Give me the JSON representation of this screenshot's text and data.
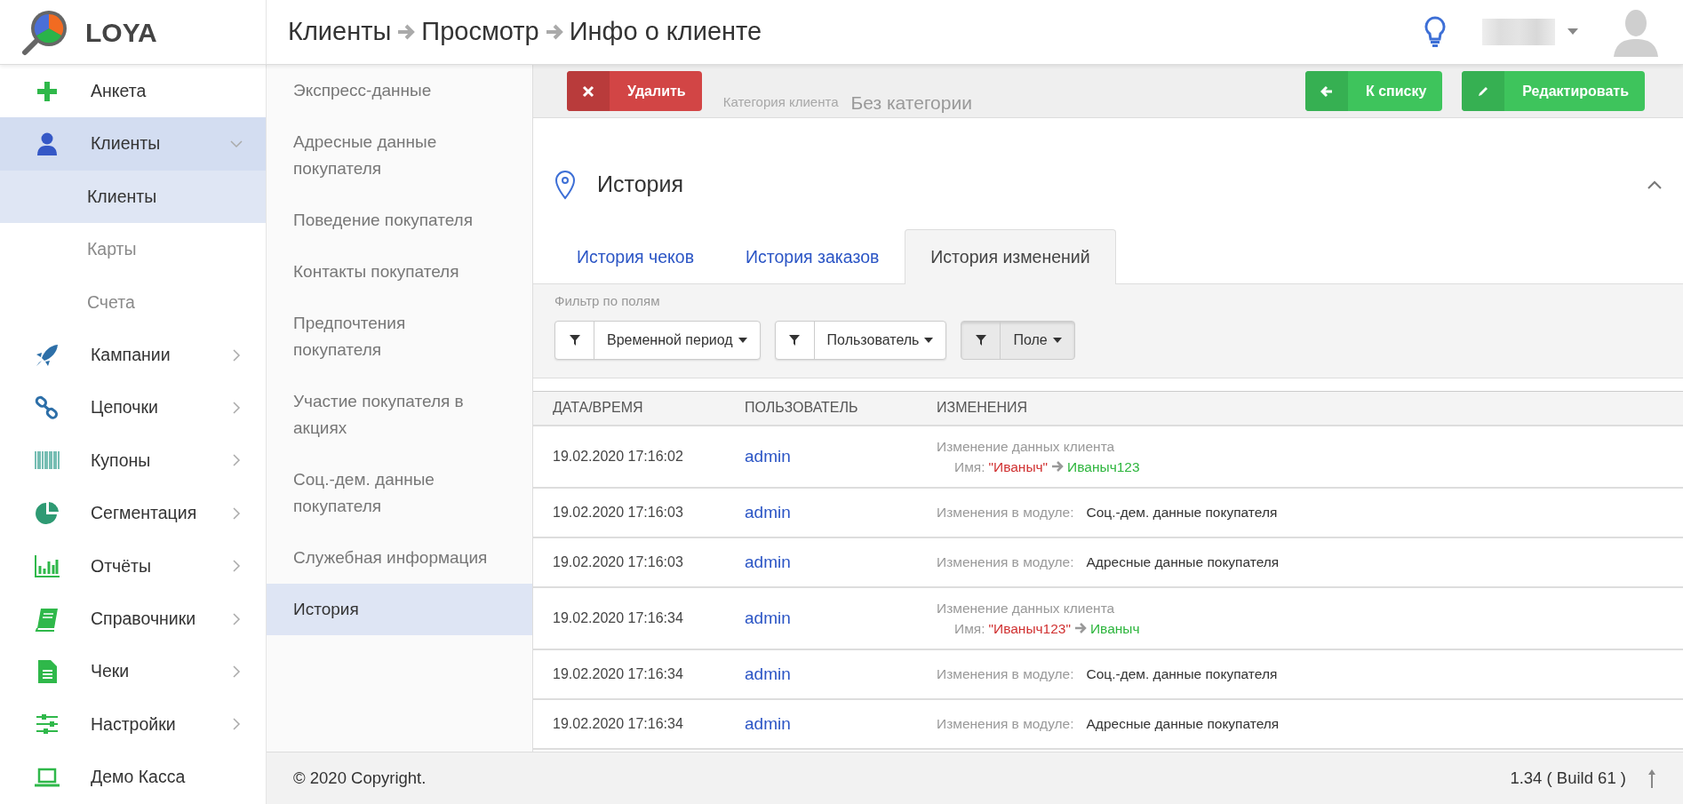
{
  "brand": {
    "name": "LOYA"
  },
  "breadcrumb": [
    "Клиенты",
    "Просмотр",
    "Инфо о клиенте"
  ],
  "sidebar": {
    "items": [
      {
        "label": "Анкета",
        "kind": "plain",
        "selected": false
      },
      {
        "label": "Клиенты",
        "kind": "group",
        "expanded": true,
        "selected": true
      },
      {
        "label": "Клиенты",
        "kind": "sub",
        "selected": true
      },
      {
        "label": "Карты",
        "kind": "sub",
        "selected": false
      },
      {
        "label": "Счета",
        "kind": "sub",
        "selected": false
      },
      {
        "label": "Кампании",
        "kind": "group",
        "expanded": false,
        "selected": false
      },
      {
        "label": "Цепочки",
        "kind": "group",
        "expanded": false,
        "selected": false
      },
      {
        "label": "Купоны",
        "kind": "group",
        "expanded": false,
        "selected": false
      },
      {
        "label": "Сегментация",
        "kind": "group",
        "expanded": false,
        "selected": false
      },
      {
        "label": "Отчёты",
        "kind": "group",
        "expanded": false,
        "selected": false
      },
      {
        "label": "Справочники",
        "kind": "group",
        "expanded": false,
        "selected": false
      },
      {
        "label": "Чеки",
        "kind": "group",
        "expanded": false,
        "selected": false
      },
      {
        "label": "Настройки",
        "kind": "group",
        "expanded": false,
        "selected": false
      },
      {
        "label": "Демо Касса",
        "kind": "plain",
        "selected": false
      }
    ]
  },
  "section_nav": {
    "items": [
      {
        "label": "Экспресс-данные",
        "selected": false
      },
      {
        "label": "Адресные данные покупателя",
        "selected": false
      },
      {
        "label": "Поведение покупателя",
        "selected": false
      },
      {
        "label": "Контакты покупателя",
        "selected": false
      },
      {
        "label": "Предпочтения покупателя",
        "selected": false
      },
      {
        "label": "Участие покупателя в акциях",
        "selected": false
      },
      {
        "label": "Соц.-дем. данные покупателя",
        "selected": false
      },
      {
        "label": "Служебная информация",
        "selected": false
      },
      {
        "label": "История",
        "selected": true
      }
    ]
  },
  "action_bar": {
    "background_field": {
      "label": "Категория клиента",
      "value": "Без категории"
    },
    "buttons": [
      {
        "label": "Удалить",
        "kind": "danger"
      },
      {
        "label": "К списку",
        "kind": "success"
      },
      {
        "label": "Редактировать",
        "kind": "success"
      }
    ]
  },
  "section": {
    "title": "История",
    "expanded": true
  },
  "tabs": [
    {
      "label": "История чеков",
      "selected": false
    },
    {
      "label": "История заказов",
      "selected": false
    },
    {
      "label": "История изменений",
      "selected": true
    }
  ],
  "filter": {
    "label": "Фильтр по полям",
    "filters": [
      {
        "label": "Временной период",
        "active": false
      },
      {
        "label": "Пользователь",
        "active": false
      },
      {
        "label": "Поле",
        "active": true
      }
    ]
  },
  "table": {
    "columns": [
      "ДАТА/ВРЕМЯ",
      "ПОЛЬЗОВАТЕЛЬ",
      "ИЗМЕНЕНИЯ"
    ],
    "rows": [
      {
        "datetime": "19.02.2020 17:16:02",
        "user": "admin",
        "kind": "change",
        "title": "Изменение данных клиента",
        "field": "Имя:",
        "old": "\"Иваныч\"",
        "new": "Иваныч123"
      },
      {
        "datetime": "19.02.2020 17:16:03",
        "user": "admin",
        "kind": "module",
        "label": "Изменения в модуле:",
        "value": "Соц.-дем. данные покупателя"
      },
      {
        "datetime": "19.02.2020 17:16:03",
        "user": "admin",
        "kind": "module",
        "label": "Изменения в модуле:",
        "value": "Адресные данные покупателя"
      },
      {
        "datetime": "19.02.2020 17:16:34",
        "user": "admin",
        "kind": "change",
        "title": "Изменение данных клиента",
        "field": "Имя:",
        "old": "\"Иваныч123\"",
        "new": "Иваныч"
      },
      {
        "datetime": "19.02.2020 17:16:34",
        "user": "admin",
        "kind": "module",
        "label": "Изменения в модуле:",
        "value": "Соц.-дем. данные покупателя"
      },
      {
        "datetime": "19.02.2020 17:16:34",
        "user": "admin",
        "kind": "module",
        "label": "Изменения в модуле:",
        "value": "Адресные данные покупателя"
      }
    ]
  },
  "footer": {
    "copyright": "© 2020 Copyright.",
    "version": "1.34 ( Build 61 )"
  }
}
